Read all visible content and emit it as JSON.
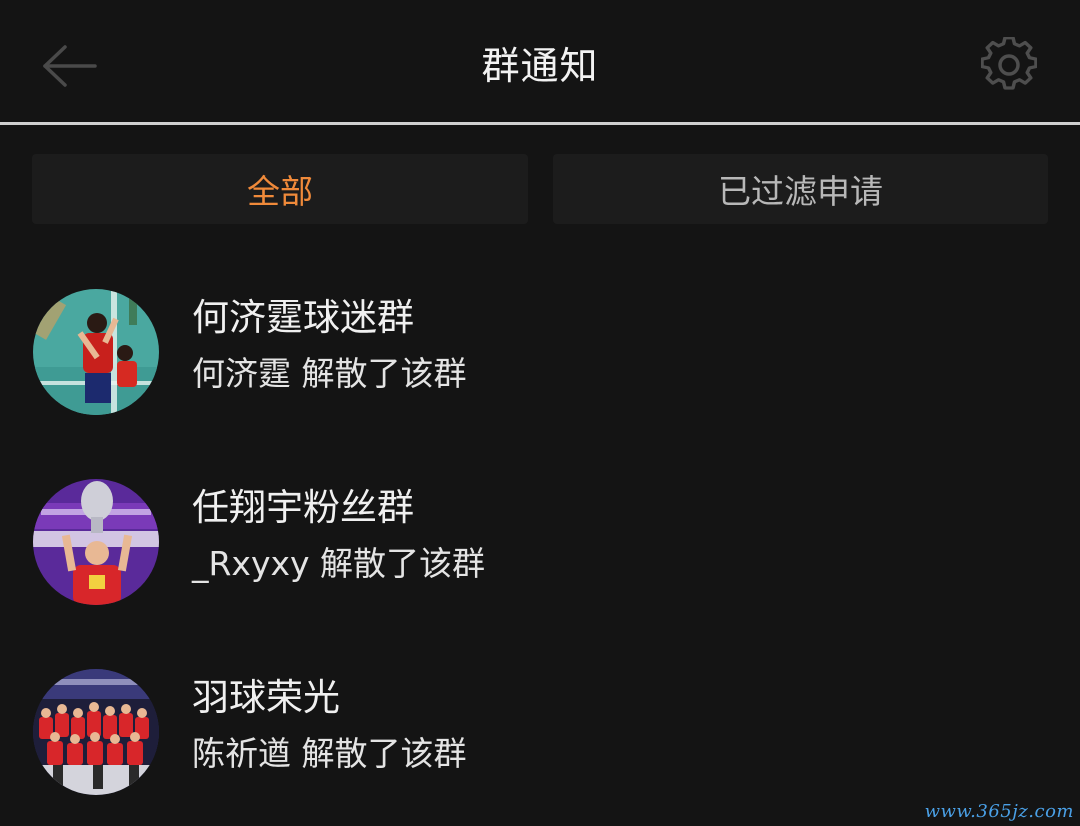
{
  "header": {
    "title": "群通知",
    "back_icon": "arrow-left-icon",
    "settings_icon": "gear-icon"
  },
  "tabs": [
    {
      "label": "全部",
      "active": true,
      "color": "#f08a3a"
    },
    {
      "label": "已过滤申请",
      "active": false,
      "color": "#b8b8b8"
    }
  ],
  "notifications": [
    {
      "group_name": "何济霆球迷群",
      "event": "何济霆 解散了该群",
      "avatar_icon": "badminton-player-avatar"
    },
    {
      "group_name": "任翔宇粉丝群",
      "event": "_Rxyxy 解散了该群",
      "avatar_icon": "trophy-player-avatar"
    },
    {
      "group_name": "羽球荣光",
      "event": "陈祈遒 解散了该群",
      "avatar_icon": "team-photo-avatar"
    }
  ],
  "watermark": "www.365jz.com",
  "colors": {
    "background": "#141414",
    "accent": "#f08a3a",
    "tab_bg": "#1c1c1c"
  }
}
